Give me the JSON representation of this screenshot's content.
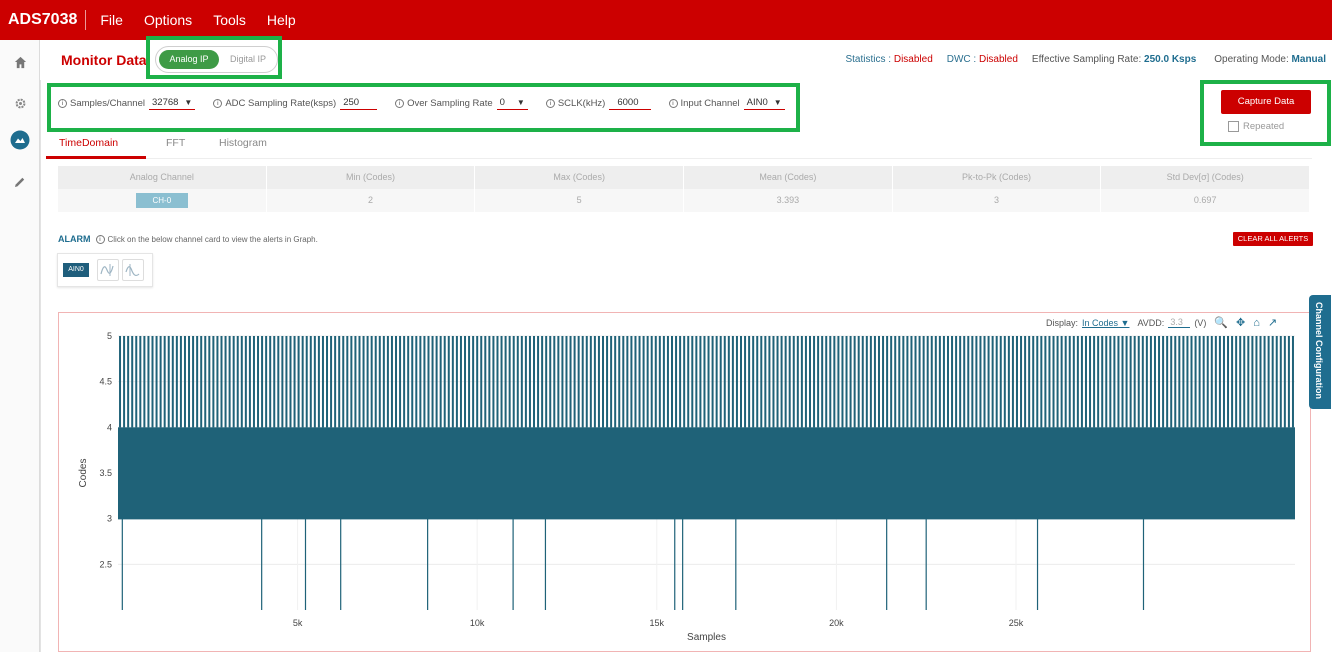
{
  "app": {
    "title": "ADS7038",
    "menu": [
      "File",
      "Options",
      "Tools",
      "Help"
    ]
  },
  "sidebar": {
    "icons": [
      "home-icon",
      "gear-icon",
      "monitor-icon",
      "pencil-icon"
    ]
  },
  "header": {
    "title": "Monitor Data",
    "toggle": {
      "on": "Analog IP",
      "off": "Digital IP"
    },
    "statistics_label": "Statistics : ",
    "statistics_value": "Disabled",
    "dwc_label": "DWC : ",
    "dwc_value": "Disabled",
    "rate_label": "Effective Sampling Rate: ",
    "rate_value": "250.0 Ksps",
    "mode_label": "Operating Mode: ",
    "mode_value": "Manual"
  },
  "config": {
    "samples_label": "Samples/Channel",
    "samples_value": "32768",
    "adc_label": "ADC Sampling Rate(ksps)",
    "adc_value": "250",
    "osr_label": "Over Sampling Rate",
    "osr_value": "0",
    "sclk_label": "SCLK(kHz)",
    "sclk_value": "6000",
    "input_label": "Input Channel",
    "input_value": "AIN0",
    "capture": "Capture Data",
    "repeated": "Repeated"
  },
  "tabs": [
    "TimeDomain",
    "FFT",
    "Histogram"
  ],
  "stats": {
    "headers": [
      "Analog Channel",
      "Min (Codes)",
      "Max (Codes)",
      "Mean (Codes)",
      "Pk-to-Pk (Codes)",
      "Std Dev[σ] (Codes)"
    ],
    "row": [
      "CH-0",
      "2",
      "5",
      "3.393",
      "3",
      "0.697"
    ]
  },
  "alarm": {
    "title": "ALARM",
    "hint": "Click on the below channel card to view the alerts in Graph.",
    "clear": "CLEAR ALL ALERTS",
    "chip": "AIN0"
  },
  "chart_tools": {
    "display_label": "Display:",
    "display_value": "In Codes",
    "avdd_label": "AVDD:",
    "avdd_value": "3.3",
    "unit": "(V)"
  },
  "side_tab": "Channel Configuration",
  "chart_data": {
    "type": "line",
    "xlabel": "Samples",
    "ylabel": "Codes",
    "xlim": [
      0,
      32768
    ],
    "ylim": [
      2,
      5
    ],
    "xticks": [
      5000,
      10000,
      15000,
      20000,
      25000
    ],
    "xtick_labels": [
      "5k",
      "10k",
      "15k",
      "20k",
      "25k"
    ],
    "yticks": [
      2.5,
      3,
      3.5,
      4,
      4.5,
      5
    ],
    "yband": [
      3,
      5
    ],
    "dense_band_top": 4,
    "dips_to_2_at": [
      120,
      4000,
      5220,
      6200,
      8620,
      11000,
      11900,
      15500,
      15720,
      17200,
      21400,
      22500,
      25600,
      28550
    ],
    "color": "#1f6278"
  }
}
